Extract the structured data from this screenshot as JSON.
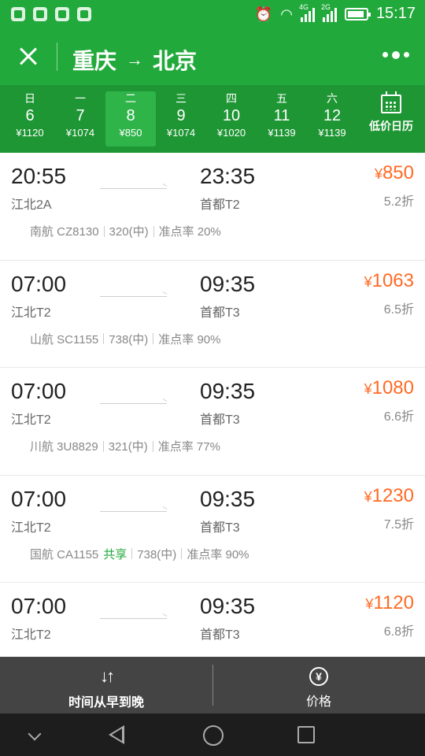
{
  "status_bar": {
    "time": "15:17",
    "network_1": "4G",
    "network_2": "2G",
    "icons": [
      "shield-app-icon",
      "swift-app-icon",
      "gallery-app-icon",
      "baidu-app-icon",
      "alarm-icon",
      "wifi-icon",
      "signal-icon",
      "battery-icon"
    ]
  },
  "header": {
    "origin": "重庆",
    "arrow": "→",
    "destination": "北京"
  },
  "dates": [
    {
      "weekday": "日",
      "date": "6",
      "price": "¥1120",
      "selected": false
    },
    {
      "weekday": "一",
      "date": "7",
      "price": "¥1074",
      "selected": false
    },
    {
      "weekday": "二",
      "date": "8",
      "price": "¥850",
      "selected": true
    },
    {
      "weekday": "三",
      "date": "9",
      "price": "¥1074",
      "selected": false
    },
    {
      "weekday": "四",
      "date": "10",
      "price": "¥1020",
      "selected": false
    },
    {
      "weekday": "五",
      "date": "11",
      "price": "¥1139",
      "selected": false
    },
    {
      "weekday": "六",
      "date": "12",
      "price": "¥1139",
      "selected": false
    }
  ],
  "calendar_label": "低价日历",
  "flights": [
    {
      "dep_time": "20:55",
      "dep_airport": "江北2A",
      "arr_time": "23:35",
      "arr_airport": "首都T2",
      "currency": "¥",
      "price": "850",
      "discount": "5.2折",
      "airline": "南航 CZ8130",
      "shared": "",
      "aircraft": "320(中)",
      "ontime": "准点率 20%"
    },
    {
      "dep_time": "07:00",
      "dep_airport": "江北T2",
      "arr_time": "09:35",
      "arr_airport": "首都T3",
      "currency": "¥",
      "price": "1063",
      "discount": "6.5折",
      "airline": "山航 SC1155",
      "shared": "",
      "aircraft": "738(中)",
      "ontime": "准点率 90%"
    },
    {
      "dep_time": "07:00",
      "dep_airport": "江北T2",
      "arr_time": "09:35",
      "arr_airport": "首都T3",
      "currency": "¥",
      "price": "1080",
      "discount": "6.6折",
      "airline": "川航 3U8829",
      "shared": "",
      "aircraft": "321(中)",
      "ontime": "准点率 77%"
    },
    {
      "dep_time": "07:00",
      "dep_airport": "江北T2",
      "arr_time": "09:35",
      "arr_airport": "首都T3",
      "currency": "¥",
      "price": "1230",
      "discount": "7.5折",
      "airline": "国航 CA1155",
      "shared": "共享",
      "aircraft": "738(中)",
      "ontime": "准点率 90%"
    },
    {
      "dep_time": "07:00",
      "dep_airport": "江北T2",
      "arr_time": "09:35",
      "arr_airport": "首都T3",
      "currency": "¥",
      "price": "1120",
      "discount": "6.8折",
      "airline": "",
      "shared": "",
      "aircraft": "",
      "ontime": ""
    }
  ],
  "bottom_bar": {
    "sort_label": "时间从早到晚",
    "price_label": "价格",
    "yen_symbol": "¥"
  }
}
